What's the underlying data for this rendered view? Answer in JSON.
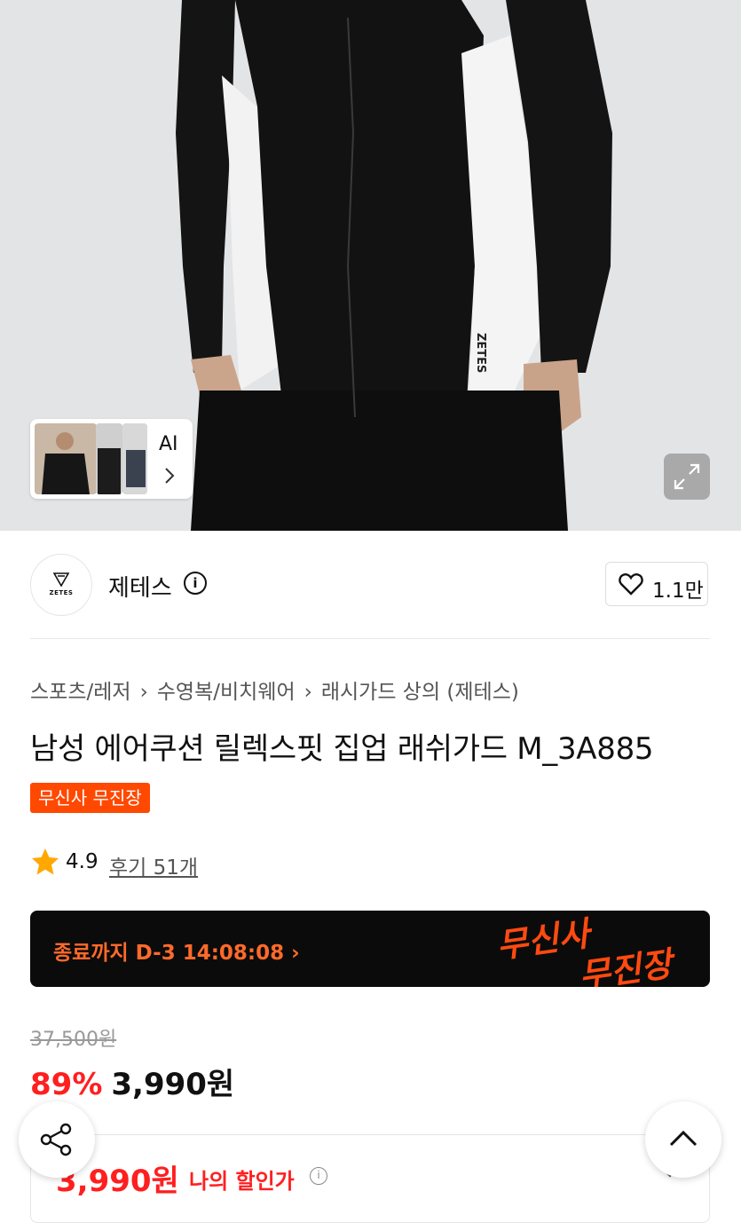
{
  "hero": {
    "ai_label": "AI",
    "shirt_print": "ZETES"
  },
  "brand": {
    "logo_text": "ZETES",
    "name": "제테스",
    "like_count": "1.1만"
  },
  "breadcrumb": [
    "스포츠/레저",
    "수영복/비치웨어",
    "래시가드 상의 (제테스)"
  ],
  "product": {
    "title": "남성 에어쿠션 릴렉스핏 집업 래쉬가드 M_3A885",
    "badge": "무신사 무진장",
    "rating": "4.9",
    "reviews": "후기 51개"
  },
  "timer": {
    "text": "종료까지 D-3 14:08:08",
    "logo_line1": "무신사",
    "logo_line2": "무진장"
  },
  "price": {
    "original": "37,500원",
    "discount": "89%",
    "sale": "3,990원",
    "my_price": "3,990원",
    "my_price_label": "나의 할인가"
  },
  "colors": {
    "accent_orange": "#ff4800",
    "price_red": "#ff1f1f",
    "timer_bg": "#0b0b0b"
  },
  "icons": [
    "info-icon",
    "heart-icon",
    "star-icon",
    "expand-icon",
    "share-icon",
    "chevron-up-icon",
    "chevron-down-icon",
    "chevron-right-icon"
  ]
}
